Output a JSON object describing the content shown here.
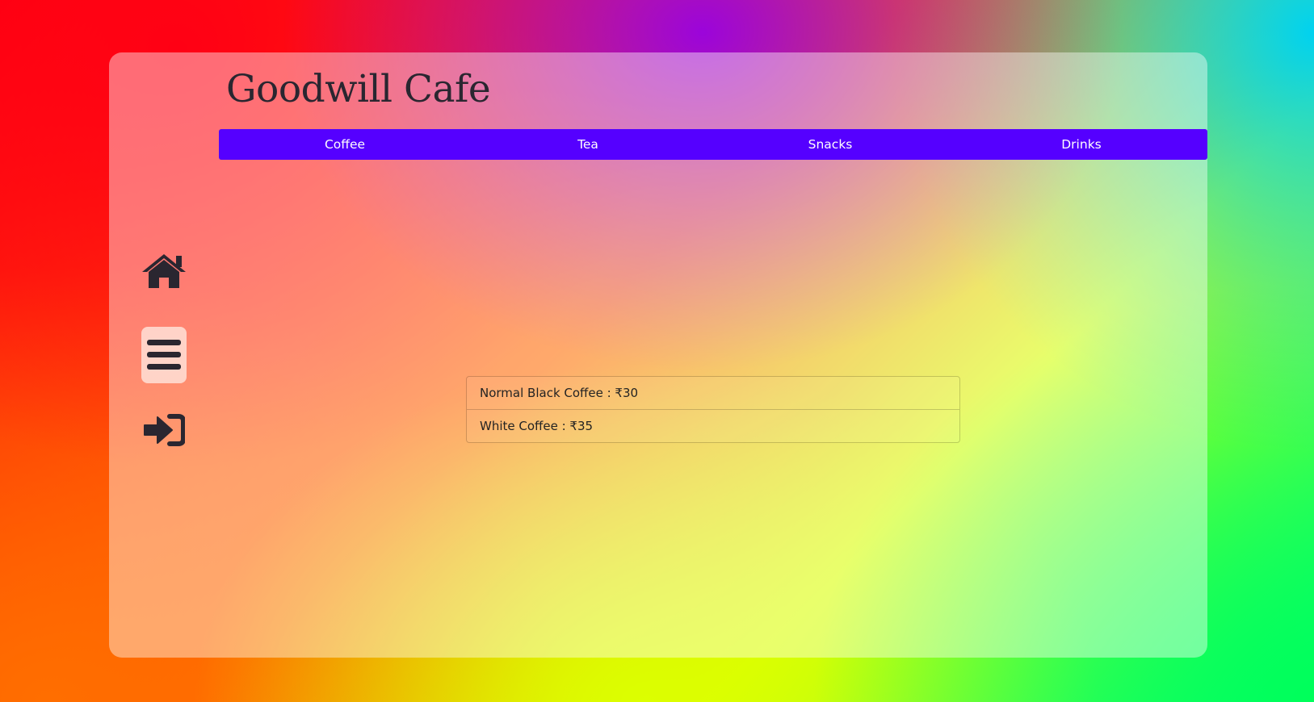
{
  "app": {
    "title": "Goodwill Cafe"
  },
  "nav": {
    "items": [
      {
        "label": "Coffee"
      },
      {
        "label": "Tea"
      },
      {
        "label": "Snacks"
      },
      {
        "label": "Drinks"
      }
    ],
    "color": "#5500ff"
  },
  "sidebar": {
    "icons": [
      {
        "name": "home-icon"
      },
      {
        "name": "menu-icon",
        "active": true
      },
      {
        "name": "login-icon"
      }
    ]
  },
  "menu": {
    "items": [
      {
        "label": "Normal Black Coffee : ₹30"
      },
      {
        "label": "White Coffee : ₹35"
      }
    ]
  },
  "colors": {
    "card_overlay": "rgba(255,255,255,0.42)",
    "active_icon_bg": "#ffe1d7",
    "text_dark": "#2a2630"
  }
}
